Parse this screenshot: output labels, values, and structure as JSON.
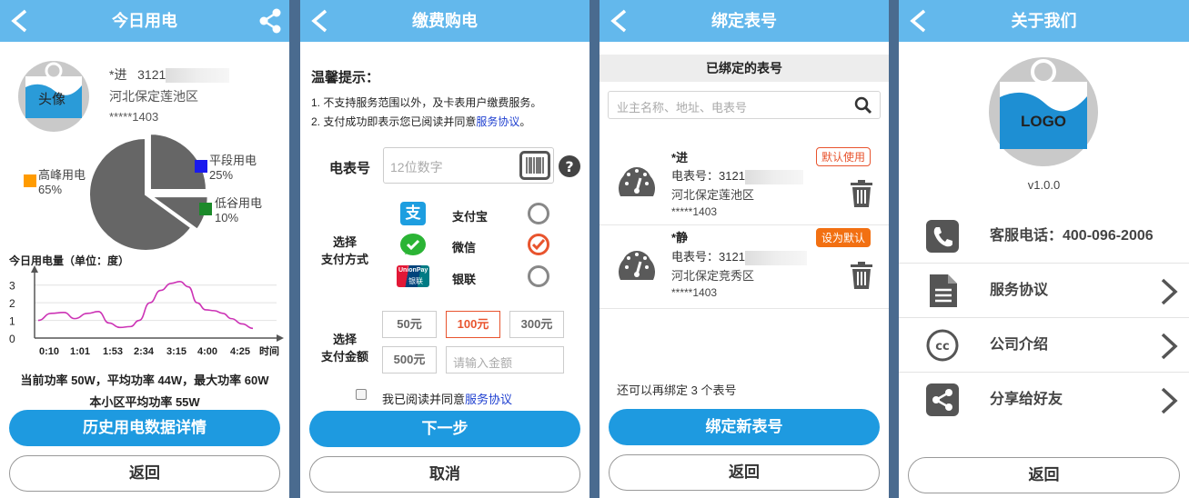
{
  "screen1": {
    "title": "今日用电",
    "avatar_label": "头像",
    "user_name": "*进",
    "user_number": "3121",
    "user_address": "河北保定莲池区",
    "user_phone": "*****1403",
    "pie": {
      "slices": [
        {
          "name": "高峰用电",
          "percent": "65%",
          "value": 65,
          "color": "#ff9b00"
        },
        {
          "name": "平段用电",
          "percent": "25%",
          "value": 25,
          "color": "#1a1aee"
        },
        {
          "name": "低谷用电",
          "percent": "10%",
          "value": 10,
          "color": "#1c8a2a"
        }
      ],
      "fill": "#666666"
    },
    "chart_title": "今日用电量（单位：度）",
    "chart_data": {
      "type": "line",
      "title": "今日用电量（单位：度）",
      "xlabel": "时间",
      "ylabel": "",
      "categories": [
        "0:10",
        "1:01",
        "1:53",
        "2:34",
        "3:15",
        "4:00",
        "4:25"
      ],
      "y_ticks": [
        "0",
        "1",
        "2",
        "3"
      ],
      "ylim": [
        0,
        3.5
      ],
      "series": [
        {
          "values": [
            1.0,
            1.5,
            0.6,
            2.0,
            3.2,
            1.4,
            0.7,
            0.0
          ],
          "x": [
            0,
            0.12,
            0.35,
            0.55,
            0.72,
            0.86,
            0.95,
            1.0
          ]
        }
      ],
      "curve_points": [
        [
          0.0,
          1.0
        ],
        [
          0.06,
          1.4
        ],
        [
          0.12,
          1.45
        ],
        [
          0.17,
          1.1
        ],
        [
          0.23,
          1.4
        ],
        [
          0.28,
          1.5
        ],
        [
          0.33,
          0.85
        ],
        [
          0.38,
          0.6
        ],
        [
          0.43,
          0.65
        ],
        [
          0.47,
          1.0
        ],
        [
          0.52,
          2.0
        ],
        [
          0.57,
          2.7
        ],
        [
          0.62,
          3.1
        ],
        [
          0.66,
          3.2
        ],
        [
          0.7,
          2.9
        ],
        [
          0.74,
          2.0
        ],
        [
          0.78,
          1.6
        ],
        [
          0.82,
          1.55
        ],
        [
          0.86,
          1.4
        ],
        [
          0.9,
          1.1
        ],
        [
          0.95,
          0.8
        ],
        [
          1.0,
          0.55
        ]
      ],
      "line_color": "#cc33b5",
      "grid": true
    },
    "stats_line1": "当前功率 50W，平均功率 44W，最大功率 60W",
    "stats_line2": "本小区平均功率 55W",
    "history_button": "历史用电数据详情",
    "back_button": "返回"
  },
  "screen2": {
    "title": "缴费购电",
    "tips_title": "温馨提示：",
    "tip1": "1. 不支持服务范围以外，及卡表用户缴费服务。",
    "tip2_prefix": "2. 支付成功即表示您已阅读并同意",
    "tip2_link": "服务协议",
    "tip2_suffix": "。",
    "meter_label": "电表号",
    "meter_placeholder": "12位数字",
    "pay_method_label_1": "选择",
    "pay_method_label_2": "支付方式",
    "methods": [
      {
        "name": "支付宝",
        "selected": false
      },
      {
        "name": "微信",
        "selected": true
      },
      {
        "name": "银联",
        "selected": false
      }
    ],
    "unionpay_text_1": "UnionPay",
    "unionpay_text_2": "银联",
    "alipay_glyph": "支",
    "amount_label_1": "选择",
    "amount_label_2": "支付金额",
    "amounts": [
      "50元",
      "100元",
      "300元",
      "500元"
    ],
    "amount_placeholder": "请输入金额",
    "agree_prefix": "我已阅读并同意",
    "agree_link": "服务协议",
    "next_button": "下一步",
    "cancel_button": "取消"
  },
  "screen3": {
    "title": "绑定表号",
    "section_title": "已绑定的表号",
    "search_placeholder": "业主名称、地址、电表号",
    "meters": [
      {
        "name": "*进",
        "number_label": "电表号：3121",
        "address": "河北保定莲池区",
        "phone": "*****1403",
        "badge": "默认使用",
        "badge_style": "outline"
      },
      {
        "name": "*静",
        "number_label": "电表号：3121",
        "address": "河北保定竞秀区",
        "phone": "*****1403",
        "badge": "设为默认",
        "badge_style": "filled"
      }
    ],
    "remaining_text": "还可以再绑定 3 个表号",
    "bind_button": "绑定新表号",
    "back_button": "返回"
  },
  "screen4": {
    "title": "关于我们",
    "logo_text": "LOGO",
    "version": "v1.0.0",
    "rows": [
      {
        "label": "客服电话：400-096-2006",
        "icon": "phone-icon",
        "chevron": false
      },
      {
        "label": "服务协议",
        "icon": "document-icon",
        "chevron": true
      },
      {
        "label": "公司介绍",
        "icon": "cc-icon",
        "chevron": true
      },
      {
        "label": "分享给好友",
        "icon": "share-icon",
        "chevron": true
      }
    ],
    "back_button": "返回"
  },
  "colors": {
    "header": "#63b8ec",
    "primary_button": "#1e9ae0",
    "accent_orange": "#e8542e",
    "link": "#1e3fd0"
  }
}
